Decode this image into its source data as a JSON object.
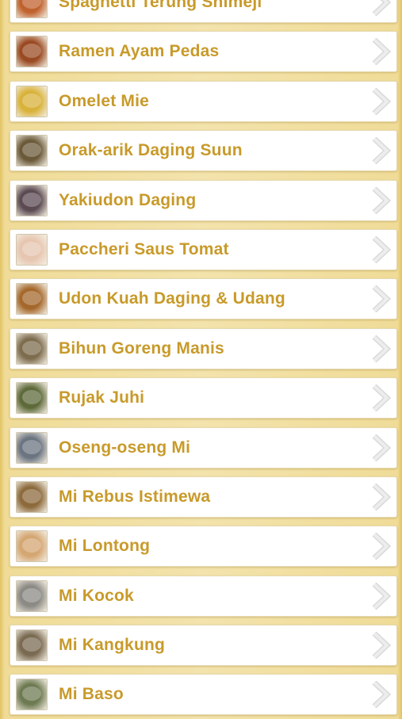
{
  "recipes": [
    {
      "label": "Spaghetti Terung Shimeji",
      "icon": "dish-thumbnail-icon",
      "tint": "#c0622e"
    },
    {
      "label": "Ramen Ayam Pedas",
      "icon": "dish-thumbnail-icon",
      "tint": "#9a4a22"
    },
    {
      "label": "Omelet Mie",
      "icon": "dish-thumbnail-icon",
      "tint": "#d9b23a"
    },
    {
      "label": "Orak-arik Daging Suun",
      "icon": "dish-thumbnail-icon",
      "tint": "#6b5a3a"
    },
    {
      "label": "Yakiudon Daging",
      "icon": "dish-thumbnail-icon",
      "tint": "#5b4a52"
    },
    {
      "label": "Paccheri Saus Tomat",
      "icon": "dish-thumbnail-icon",
      "tint": "#e6c6b0"
    },
    {
      "label": "Udon Kuah Daging & Udang",
      "icon": "dish-thumbnail-icon",
      "tint": "#a5682c"
    },
    {
      "label": "Bihun Goreng Manis",
      "icon": "dish-thumbnail-icon",
      "tint": "#7d6c4e"
    },
    {
      "label": "Rujak Juhi",
      "icon": "dish-thumbnail-icon",
      "tint": "#5e6a3a"
    },
    {
      "label": "Oseng-oseng Mi",
      "icon": "dish-thumbnail-icon",
      "tint": "#6b7480"
    },
    {
      "label": "Mi Rebus Istimewa",
      "icon": "dish-thumbnail-icon",
      "tint": "#8c6a3c"
    },
    {
      "label": "Mi Lontong",
      "icon": "dish-thumbnail-icon",
      "tint": "#d4a672"
    },
    {
      "label": "Mi Kocok",
      "icon": "dish-thumbnail-icon",
      "tint": "#8c8a84"
    },
    {
      "label": "Mi Kangkung",
      "icon": "dish-thumbnail-icon",
      "tint": "#7a6a52"
    },
    {
      "label": "Mi Baso",
      "icon": "dish-thumbnail-icon",
      "tint": "#6e7a52"
    }
  ],
  "colors": {
    "label_text": "#c89a2a",
    "chevron": "#e4e4e4",
    "background": "#f0dc98"
  }
}
